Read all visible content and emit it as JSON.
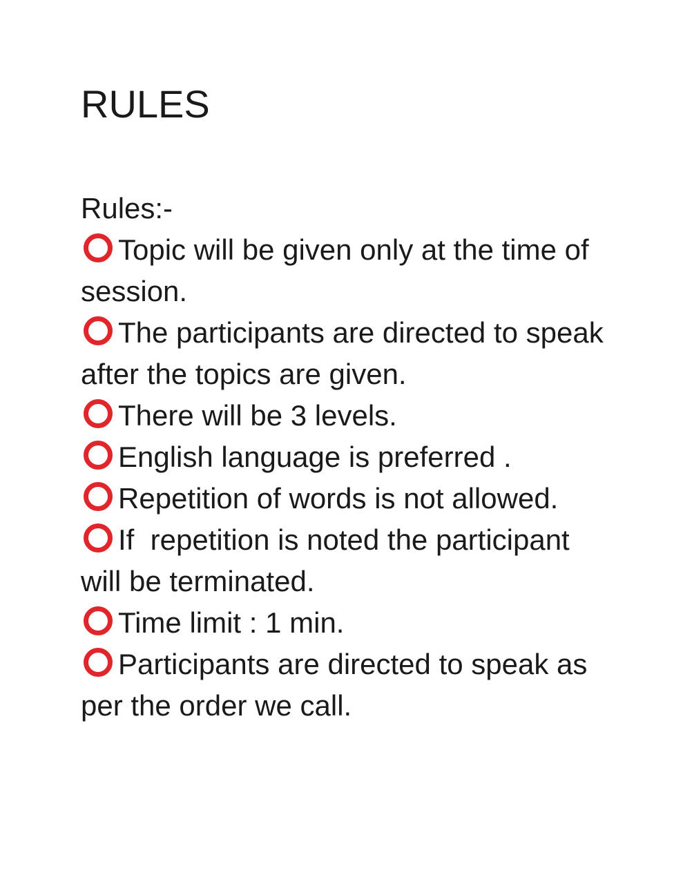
{
  "document": {
    "title": "RULES",
    "subheading": "Rules:-",
    "bullet_icon": "red-hollow-circle-icon",
    "bullet_color": "#e0252b",
    "rules": [
      "Topic will be given only at the time of session.",
      "The participants are directed to speak after the topics are given.",
      "There will be 3 levels.",
      "English language is preferred .",
      "Repetition of words is not allowed.",
      "If  repetition is noted the participant will be terminated.",
      "Time limit : 1 min.",
      "Participants are directed to speak as per the order we call."
    ]
  }
}
